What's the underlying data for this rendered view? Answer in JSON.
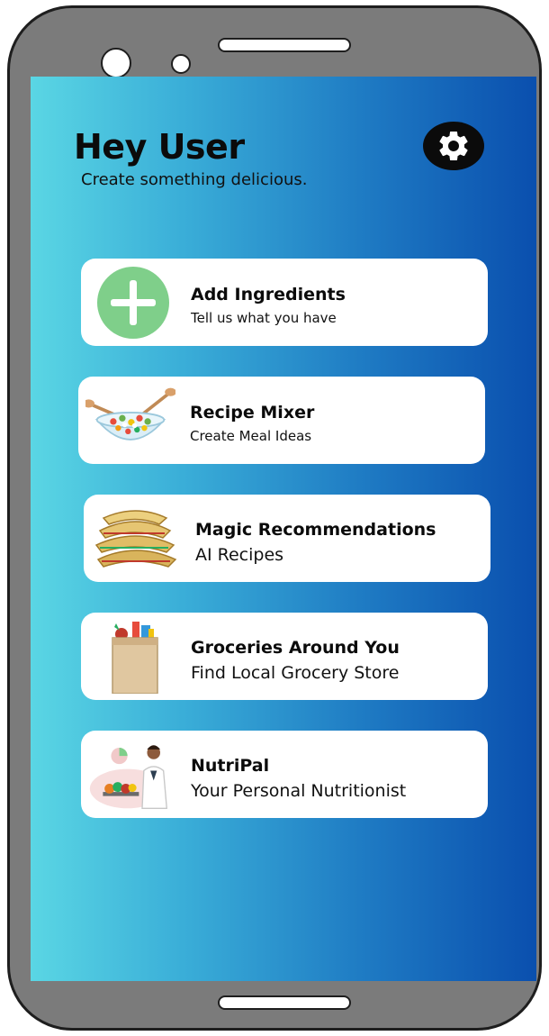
{
  "header": {
    "greeting": "Hey User",
    "subtitle": "Create something delicious."
  },
  "cards": [
    {
      "title": "Add Ingredients",
      "description": "Tell us what you have",
      "icon": "plus-icon"
    },
    {
      "title": "Recipe Mixer",
      "description": "Create Meal Ideas",
      "icon": "salad-bowl-icon"
    },
    {
      "title": "Magic Recommendations",
      "description": "AI Recipes",
      "icon": "quesadilla-stack-icon"
    },
    {
      "title": "Groceries Around You",
      "description": "Find Local Grocery Store",
      "icon": "grocery-bag-icon"
    },
    {
      "title": "NutriPal",
      "description": "Your Personal Nutritionist",
      "icon": "nutritionist-icon"
    }
  ],
  "colors": {
    "gradient_start": "#5ad6e4",
    "gradient_end": "#0a4fae",
    "plus_green": "#7fcf8a",
    "phone_frame": "#7b7b7b"
  }
}
